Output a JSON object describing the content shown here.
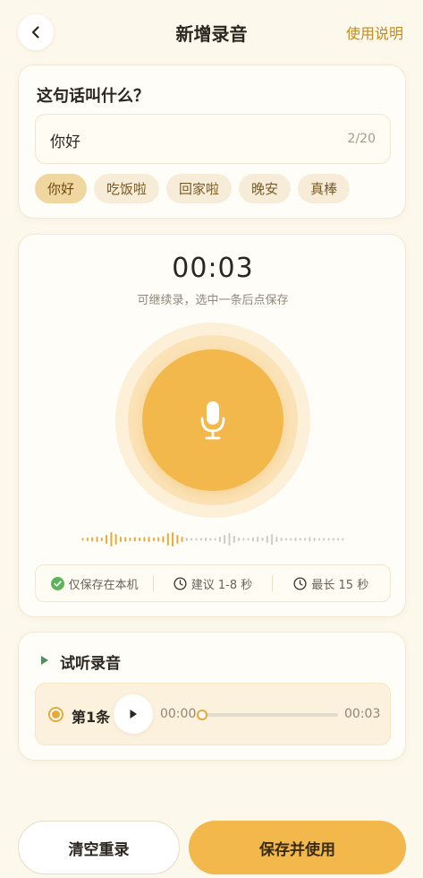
{
  "header": {
    "title": "新增录音",
    "help_label": "使用说明"
  },
  "name_section": {
    "question": "这句话叫什么？",
    "input_value": "你好",
    "char_count": "2/20",
    "chips": [
      "你好",
      "吃饭啦",
      "回家啦",
      "晚安",
      "真棒"
    ],
    "active_chip": 0
  },
  "record_section": {
    "timer": "00:03",
    "hint": "可继续录，选中一条后点保存",
    "info": [
      {
        "icon": "check-circle-icon",
        "text": "仅保存在本机"
      },
      {
        "icon": "clock-icon",
        "text": "建议 1-8 秒"
      },
      {
        "icon": "clock-icon",
        "text": "最长 15 秒"
      }
    ],
    "recorded_fraction": 0.4
  },
  "preview_section": {
    "title": "试听录音",
    "clip": {
      "label": "第1条",
      "current_time": "00:00",
      "duration": "00:03",
      "selected": true,
      "progress": 0
    }
  },
  "footer": {
    "clear_label": "清空重录",
    "save_label": "保存并使用"
  },
  "colors": {
    "accent": "#f2b84b",
    "accent_text": "#c48a1e",
    "background": "#fdf8ec",
    "success": "#5db35b"
  }
}
